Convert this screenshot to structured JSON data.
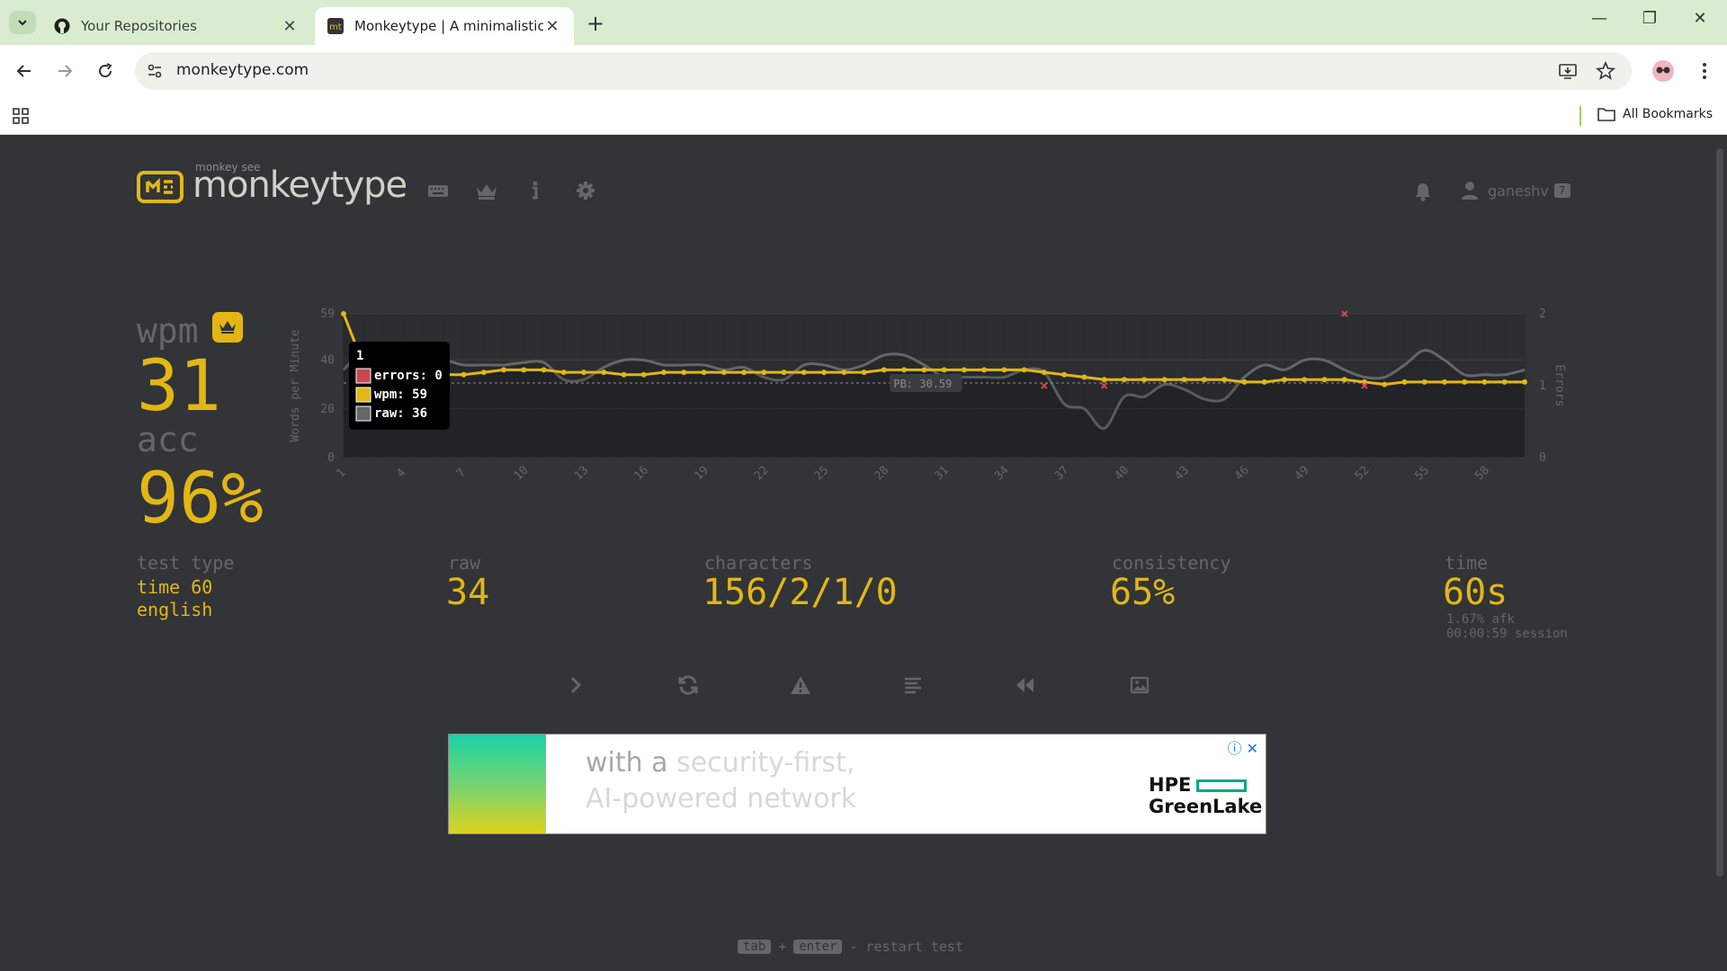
{
  "browser": {
    "tabs": [
      {
        "title": "Your Repositories",
        "active": false
      },
      {
        "title": "Monkeytype | A minimalistic, cu",
        "active": true
      }
    ],
    "url": "monkeytype.com",
    "bookmarks_label": "All Bookmarks"
  },
  "app": {
    "logo_sub": "monkey see",
    "logo_name": "monkeytype",
    "username": "ganeshv",
    "user_level": "7"
  },
  "result": {
    "wpm_label": "wpm",
    "wpm_value": "31",
    "acc_label": "acc",
    "acc_value": "96%",
    "test_type_label": "test type",
    "test_type_lines": [
      "time 60",
      "english"
    ],
    "raw_label": "raw",
    "raw_value": "34",
    "characters_label": "characters",
    "characters_value": "156/2/1/0",
    "consistency_label": "consistency",
    "consistency_value": "65%",
    "time_label": "time",
    "time_value": "60s",
    "afk": "1.67% afk",
    "session": "00:00:59 session"
  },
  "tooltip": {
    "title": "1",
    "errors": "errors: 0",
    "wpm": "wpm: 59",
    "raw": "raw: 36"
  },
  "pb_label": "PB: 30.59",
  "chart_data": {
    "type": "line",
    "ylabel": "Words per Minute",
    "y2label": "Errors",
    "ylim": [
      0,
      59
    ],
    "y2lim": [
      0,
      2
    ],
    "yticks": [
      "59",
      "40",
      "20",
      "0"
    ],
    "y2ticks": [
      "2",
      "1",
      "0"
    ],
    "xticks": [
      "1",
      "4",
      "7",
      "10",
      "13",
      "16",
      "19",
      "22",
      "25",
      "28",
      "31",
      "34",
      "37",
      "40",
      "43",
      "46",
      "49",
      "52",
      "55",
      "58"
    ],
    "x": [
      1,
      2,
      3,
      4,
      5,
      6,
      7,
      8,
      9,
      10,
      11,
      12,
      13,
      14,
      15,
      16,
      17,
      18,
      19,
      20,
      21,
      22,
      23,
      24,
      25,
      26,
      27,
      28,
      29,
      30,
      31,
      32,
      33,
      34,
      35,
      36,
      37,
      38,
      39,
      40,
      41,
      42,
      43,
      44,
      45,
      46,
      47,
      48,
      49,
      50,
      51,
      52,
      53,
      54,
      55,
      56,
      57,
      58,
      59,
      60
    ],
    "pb": 30.59,
    "series": [
      {
        "name": "wpm",
        "color": "#e2b714",
        "values": [
          59,
          38,
          34,
          34,
          34,
          34,
          34,
          35,
          36,
          36,
          36,
          35,
          35,
          35,
          34,
          34,
          35,
          35,
          35,
          35,
          35,
          35,
          35,
          35,
          35,
          35,
          35,
          36,
          36,
          36,
          36,
          36,
          36,
          36,
          36,
          35,
          34,
          33,
          32,
          32,
          32,
          32,
          32,
          32,
          32,
          31,
          31,
          32,
          32,
          32,
          32,
          31,
          30,
          31,
          31,
          31,
          31,
          31,
          31,
          31
        ]
      },
      {
        "name": "raw",
        "color": "#646669",
        "values": [
          36,
          44,
          46,
          40,
          40,
          40,
          38,
          38,
          38,
          39,
          39,
          32,
          32,
          37,
          40,
          40,
          38,
          38,
          38,
          36,
          37,
          33,
          32,
          38,
          38,
          36,
          38,
          42,
          42,
          38,
          33,
          33,
          33,
          33,
          36,
          35,
          22,
          20,
          12,
          25,
          25,
          30,
          28,
          24,
          24,
          33,
          38,
          36,
          40,
          40,
          36,
          33,
          33,
          38,
          44,
          40,
          34,
          34,
          34,
          36
        ]
      },
      {
        "name": "errors",
        "color": "#ca4754",
        "points": [
          [
            36,
            1
          ],
          [
            39,
            1
          ],
          [
            51,
            2
          ],
          [
            52,
            1
          ]
        ]
      }
    ]
  },
  "footer_hint": {
    "key1": "tab",
    "plus": "+",
    "key2": "enter",
    "text": "- restart test"
  }
}
